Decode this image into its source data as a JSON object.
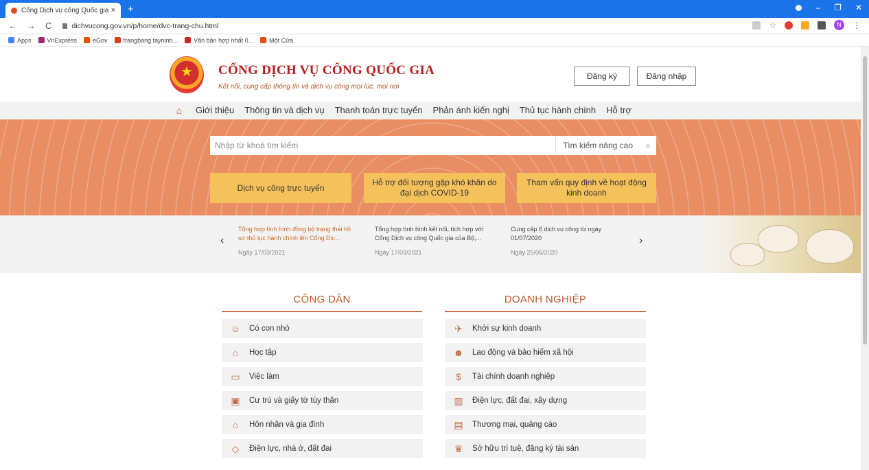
{
  "browser": {
    "tab_title": "Cổng Dịch vụ công Quốc gia",
    "url": "dichvucong.gov.vn/p/home/dvc-trang-chu.html",
    "profile_initial": "N",
    "bookmarks": [
      {
        "label": "Apps",
        "color": "#4285f4"
      },
      {
        "label": "VnExpress",
        "color": "#9c2a6e"
      },
      {
        "label": "eGov",
        "color": "#e65100"
      },
      {
        "label": "trangbang.tayninh...",
        "color": "#d84315"
      },
      {
        "label": "Văn bản hợp nhất 0...",
        "color": "#c62828"
      },
      {
        "label": "Một Cửa",
        "color": "#e64a19"
      }
    ]
  },
  "header": {
    "title": "CỔNG DỊCH VỤ CÔNG QUỐC GIA",
    "subtitle": "Kết nối, cung cấp thông tin và dịch vụ công mọi lúc, mọi nơi",
    "register_label": "Đăng ký",
    "login_label": "Đăng nhập"
  },
  "menu": [
    "Giới thiệu",
    "Thông tin và dịch vụ",
    "Thanh toán trực tuyến",
    "Phản ánh kiến nghị",
    "Thủ tục hành chính",
    "Hỗ trợ"
  ],
  "search": {
    "placeholder": "Nhập từ khoá tìm kiếm",
    "advanced_label": "Tìm kiếm nâng cao"
  },
  "cta": [
    "Dịch vụ công trực tuyến",
    "Hỗ trợ đối tượng gặp khó khăn do đại dịch COVID-19",
    "Tham vấn quy định về hoạt động kinh doanh"
  ],
  "news": [
    {
      "title": "Tổng hợp tình hình đồng bộ trạng thái hồ sơ thủ tục hành chính lên Cổng Dịc...",
      "date": "Ngày 17/03/2021"
    },
    {
      "title": "Tổng hợp tình hình kết nối, tích hợp với Cổng Dịch vụ công Quốc gia của Bộ,...",
      "date": "Ngày 17/03/2021"
    },
    {
      "title": "Cung cấp 6 dịch vụ công từ ngày 01/07/2020",
      "date": "Ngày 25/06/2020"
    }
  ],
  "citizen": {
    "title": "CÔNG DÂN",
    "items": [
      {
        "label": "Có con nhỏ",
        "icon": "baby-icon"
      },
      {
        "label": "Học tập",
        "icon": "graduation-cap-icon"
      },
      {
        "label": "Việc làm",
        "icon": "briefcase-icon"
      },
      {
        "label": "Cư trú và giấy tờ tùy thân",
        "icon": "id-card-icon"
      },
      {
        "label": "Hôn nhân và gia đình",
        "icon": "family-house-icon"
      },
      {
        "label": "Điện lực, nhà ở, đất đai",
        "icon": "home-land-icon"
      }
    ]
  },
  "business": {
    "title": "DOANH NGHIỆP",
    "items": [
      {
        "label": "Khởi sự kinh doanh",
        "icon": "rocket-icon"
      },
      {
        "label": "Lao động và bảo hiểm xã hội",
        "icon": "people-icon"
      },
      {
        "label": "Tài chính doanh nghiệp",
        "icon": "dollar-icon"
      },
      {
        "label": "Điện lực, đất đai, xây dựng",
        "icon": "building-icon"
      },
      {
        "label": "Thương mại, quảng cáo",
        "icon": "billboard-icon"
      },
      {
        "label": "Sở hữu trí tuệ, đăng ký tài sản",
        "icon": "award-icon"
      }
    ]
  },
  "colors": {
    "accent": "#c15a2a",
    "hero": "#e98e63",
    "cta": "#f5c15a",
    "tabbar": "#1a73e8"
  }
}
